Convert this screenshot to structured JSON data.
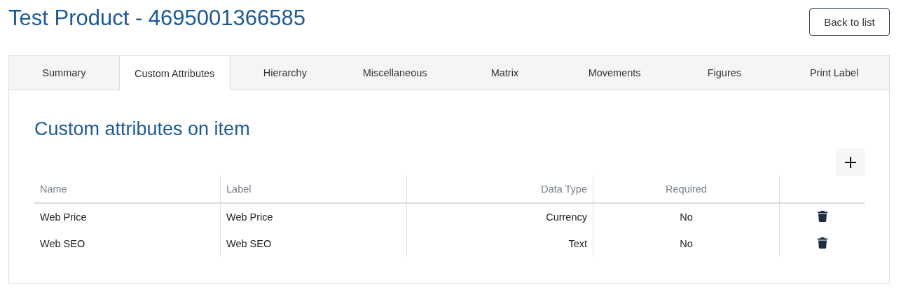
{
  "page": {
    "title": "Test Product - 4695001366585",
    "back_button": "Back to list"
  },
  "tabs": [
    {
      "label": "Summary",
      "selected": false
    },
    {
      "label": "Custom Attributes",
      "selected": true
    },
    {
      "label": "Hierarchy",
      "selected": false
    },
    {
      "label": "Miscellaneous",
      "selected": false
    },
    {
      "label": "Matrix",
      "selected": false
    },
    {
      "label": "Movements",
      "selected": false
    },
    {
      "label": "Figures",
      "selected": false
    },
    {
      "label": "Print Label",
      "selected": false
    }
  ],
  "section": {
    "heading": "Custom attributes on item"
  },
  "table": {
    "columns": [
      "Name",
      "Label",
      "Data Type",
      "Required"
    ],
    "rows": [
      {
        "cells": [
          "Web Price",
          "Web Price",
          "Currency",
          "No"
        ]
      },
      {
        "cells": [
          "Web SEO",
          "Web SEO",
          "Text",
          "No"
        ]
      }
    ]
  }
}
